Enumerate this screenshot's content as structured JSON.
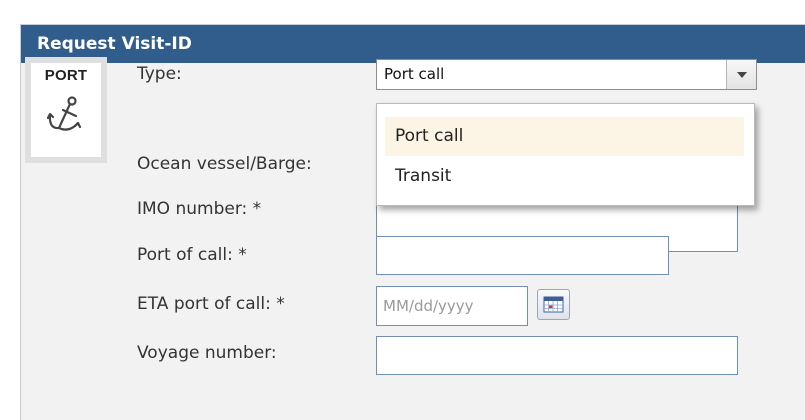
{
  "panel": {
    "title": "Request Visit-ID",
    "header_color": "#315d8c"
  },
  "badge": {
    "text": "PORT",
    "icon": "anchor-icon"
  },
  "form": {
    "type_label": "Type:",
    "type_value": "Port call",
    "type_options": [
      "Port call",
      "Transit"
    ],
    "highlighted_option": "Port call",
    "vessel_label": "Ocean vessel/Barge:",
    "imo_label": "IMO number: *",
    "imo_value": "",
    "port_label": "Port of call: *",
    "port_value": "",
    "eta_label": "ETA port of call: *",
    "eta_placeholder": "MM/dd/yyyy",
    "eta_icon": "calendar-icon",
    "voyage_label": "Voyage number:",
    "voyage_value": ""
  }
}
